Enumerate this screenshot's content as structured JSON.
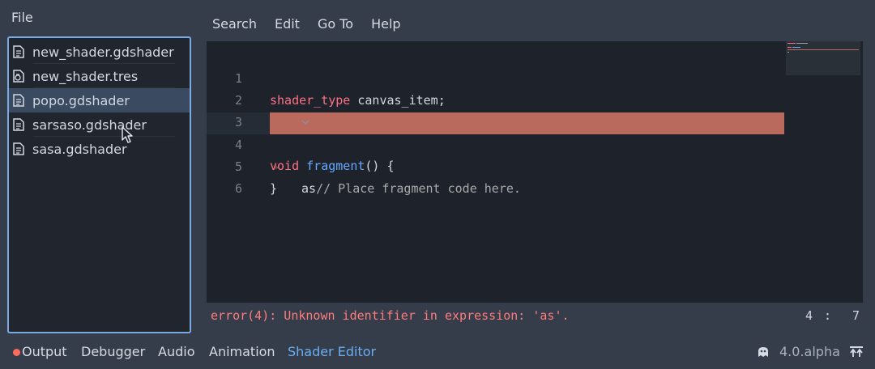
{
  "left_menu": {
    "file": "File"
  },
  "files": [
    {
      "name": "new_shader.gdshader",
      "icon": "shader-file-icon"
    },
    {
      "name": "new_shader.tres",
      "icon": "resource-file-icon"
    },
    {
      "name": "popo.gdshader",
      "icon": "shader-file-icon",
      "selected": true
    },
    {
      "name": "sarsaso.gdshader",
      "icon": "shader-file-icon"
    },
    {
      "name": "sasa.gdshader",
      "icon": "shader-file-icon"
    }
  ],
  "editor_menu": {
    "search": "Search",
    "edit": "Edit",
    "goto": "Go To",
    "help": "Help"
  },
  "code": {
    "line_numbers": [
      "1",
      "2",
      "3",
      "4",
      "5",
      "6"
    ],
    "line1_kw": "shader_type",
    "line1_rest": " canvas_item;",
    "line3_kw": "void",
    "line3_fn": "fragment",
    "line3_rest": "() {",
    "line4_code": "as",
    "line4_comment": "// Place fragment code here.",
    "line5": "}"
  },
  "status": {
    "error": "error(4): Unknown identifier in expression: 'as'.",
    "line": "4",
    "sep": ":",
    "col": "7"
  },
  "bottom_tabs": {
    "output": "Output",
    "debugger": "Debugger",
    "audio": "Audio",
    "animation": "Animation",
    "shader_editor": "Shader Editor"
  },
  "version": "4.0.alpha",
  "colors": {
    "accent": "#6aaef2",
    "error": "#ff7c7c",
    "error_line": "#b96a5c",
    "keyword": "#ff7085",
    "function": "#66a8ff"
  }
}
